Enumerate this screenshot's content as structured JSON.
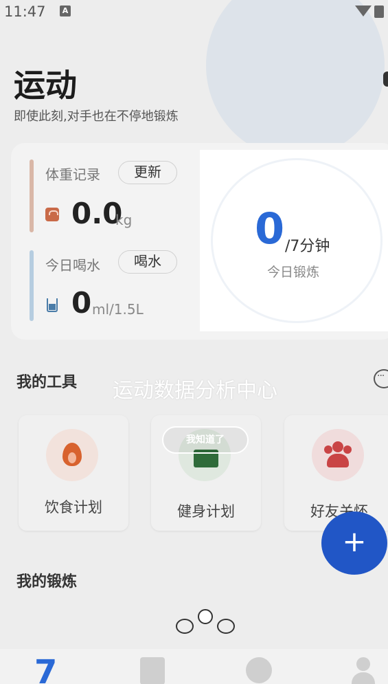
{
  "status_bar": {
    "time": "11:47",
    "notif": "A"
  },
  "header": {
    "title": "运动",
    "subtitle": "即使此刻,对手也在不停地锻炼"
  },
  "weight": {
    "label": "体重记录",
    "button": "更新",
    "value": "0.0",
    "unit": "kg"
  },
  "water": {
    "label": "今日喝水",
    "button": "喝水",
    "value": "0",
    "unit": "ml/1.5L"
  },
  "exercise": {
    "value": "0",
    "target": "/7分钟",
    "label": "今日锻炼"
  },
  "tools": {
    "title": "我的工具",
    "items": [
      {
        "label": "饮食计划",
        "icon": "flame-icon"
      },
      {
        "label": "健身计划",
        "icon": "briefcase-icon"
      },
      {
        "label": "好友关怀",
        "icon": "people-icon"
      }
    ]
  },
  "overlay": {
    "hint_title": "运动数据分析中心",
    "dismiss_label": "我知道了"
  },
  "fab": {
    "label": "+"
  },
  "workouts": {
    "title": "我的锻炼"
  },
  "nav": {
    "home_glyph": "7"
  },
  "colors": {
    "accent": "#2a69d6",
    "fab": "#2156c6"
  }
}
